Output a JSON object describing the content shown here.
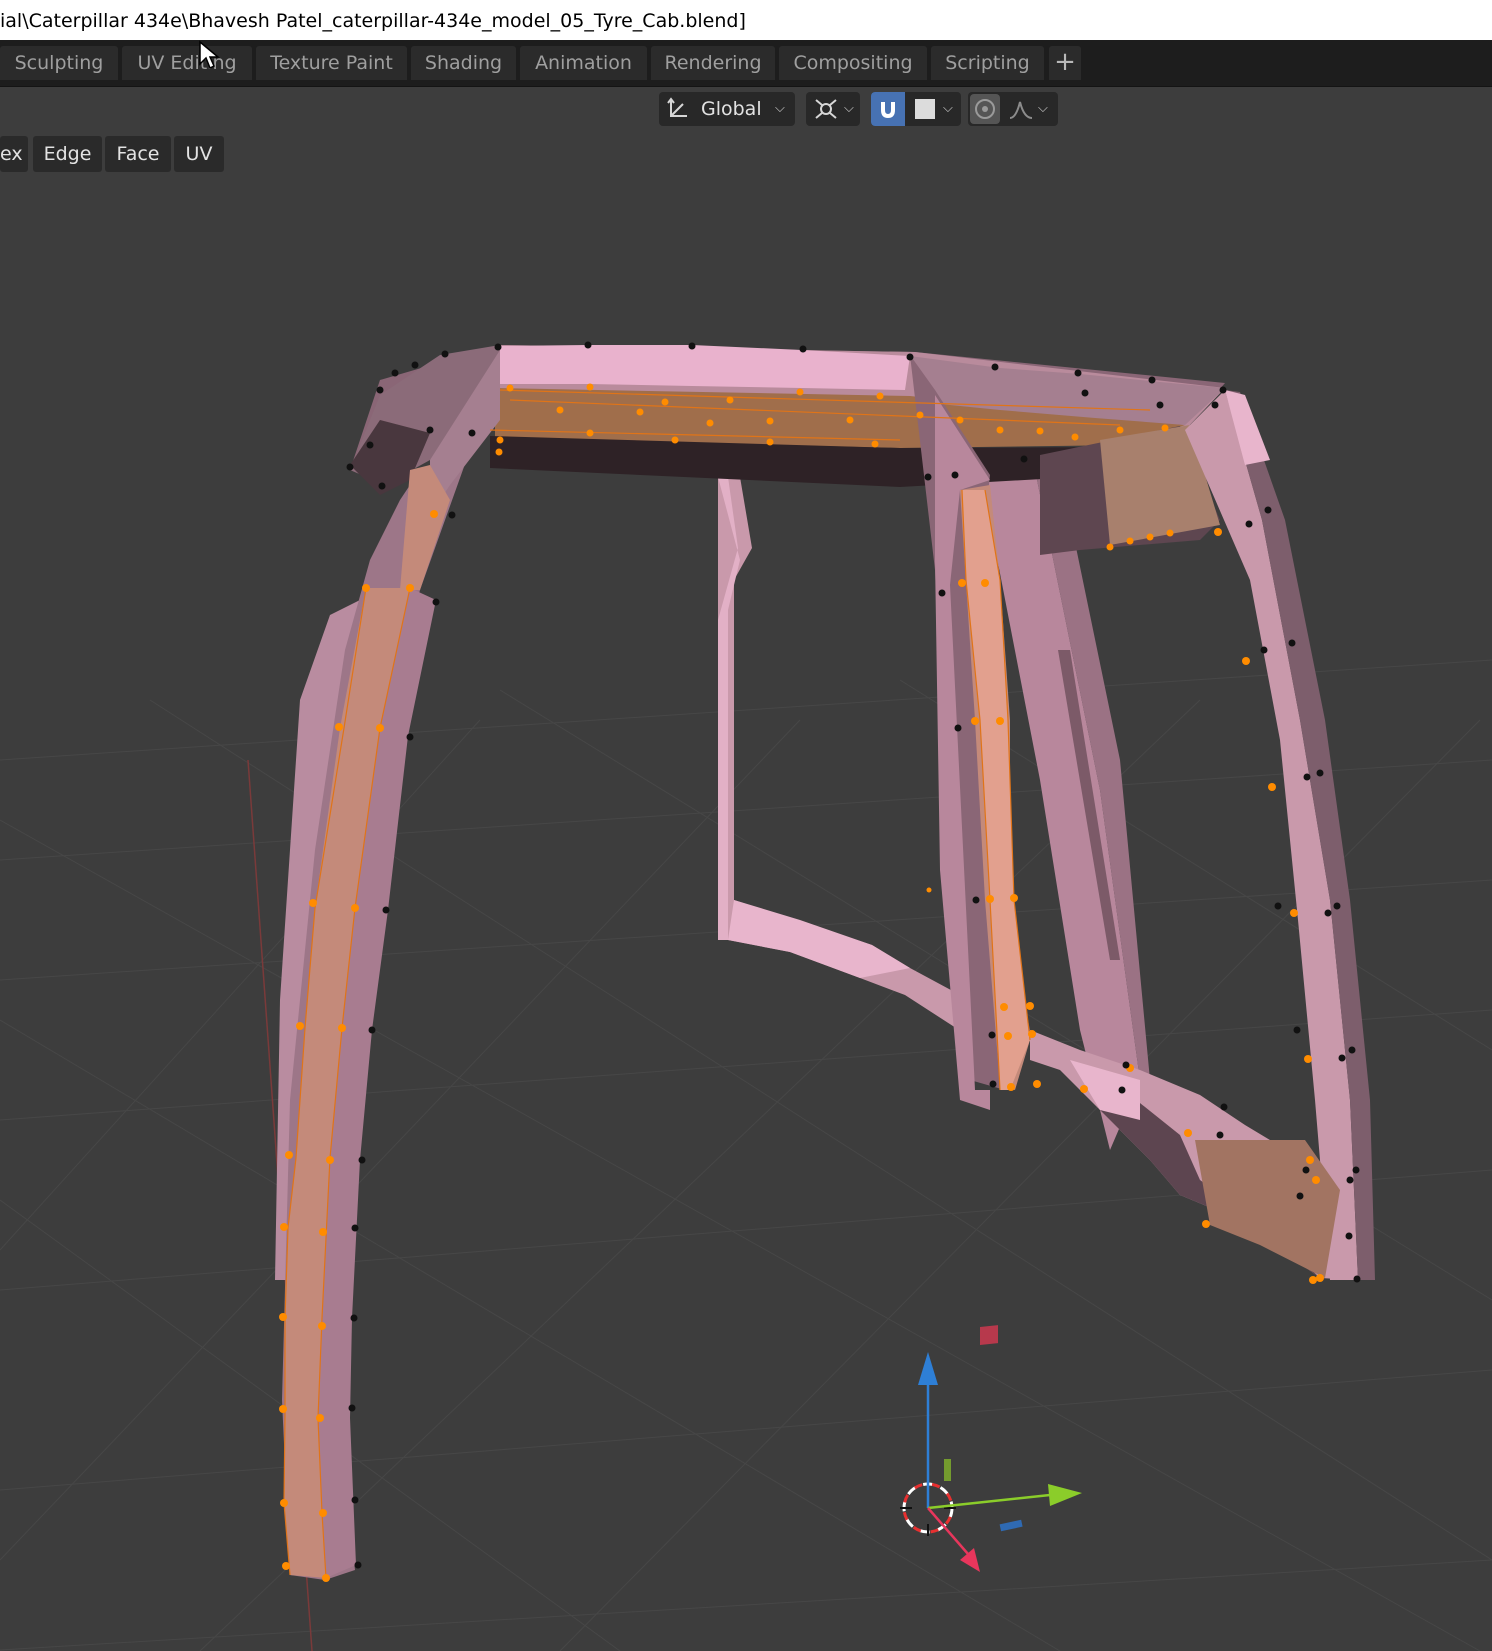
{
  "window": {
    "title": "ial\\Caterpillar 434e\\Bhavesh Patel_caterpillar-434e_model_05_Tyre_Cab.blend]"
  },
  "workspace_tabs": [
    {
      "label": "Sculpting"
    },
    {
      "label": "UV Editing"
    },
    {
      "label": "Texture Paint"
    },
    {
      "label": "Shading"
    },
    {
      "label": "Animation"
    },
    {
      "label": "Rendering"
    },
    {
      "label": "Compositing"
    },
    {
      "label": "Scripting"
    }
  ],
  "add_workspace": "+",
  "viewport_header": {
    "transform_orientation": "Global",
    "pivot_icon": "pivot-point-icon",
    "snap_icon": "magnet-icon",
    "snap_enabled": true,
    "snap_target_icon": "square-snap-icon",
    "proportional_edit_icon": "proportional-edit-icon",
    "falloff_icon": "falloff-curve-icon"
  },
  "edit_menus": {
    "vertex": "ex",
    "edge": "Edge",
    "face": "Face",
    "uv": "UV"
  },
  "colors": {
    "mesh_face": "#c999ab",
    "mesh_face_light": "#e8b5cc",
    "mesh_face_dark": "#8a6676",
    "selected_face": "#c48a7a",
    "selected_vertex": "#ff8c00",
    "unselected_vertex": "#000000",
    "viewport_bg": "#3d3d3d",
    "axis_x": "#e8365c",
    "axis_y": "#8bcd2a",
    "axis_z": "#2e7fd6"
  }
}
